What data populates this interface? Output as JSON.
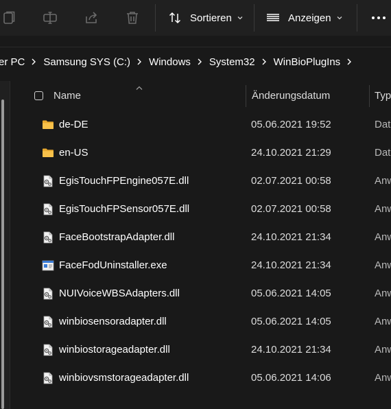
{
  "toolbar": {
    "sort_label": "Sortieren",
    "view_label": "Anzeigen",
    "icons": [
      "copy-icon",
      "rename-icon",
      "share-icon",
      "delete-icon",
      "sort-icon",
      "view-icon",
      "more-icon"
    ]
  },
  "breadcrumb": [
    "er PC",
    "Samsung SYS (C:)",
    "Windows",
    "System32",
    "WinBioPlugIns"
  ],
  "columns": {
    "name": "Name",
    "date": "Änderungsdatum",
    "type": "Typ"
  },
  "files": [
    {
      "name": "de-DE",
      "date": "05.06.2021 19:52",
      "type": "Dat",
      "icon": "folder-icon"
    },
    {
      "name": "en-US",
      "date": "24.10.2021 21:29",
      "type": "Dat",
      "icon": "folder-icon"
    },
    {
      "name": "EgisTouchFPEngine057E.dll",
      "date": "02.07.2021 00:58",
      "type": "Anw",
      "icon": "dll-file-icon"
    },
    {
      "name": "EgisTouchFPSensor057E.dll",
      "date": "02.07.2021 00:58",
      "type": "Anw",
      "icon": "dll-file-icon"
    },
    {
      "name": "FaceBootstrapAdapter.dll",
      "date": "24.10.2021 21:34",
      "type": "Anw",
      "icon": "dll-file-icon"
    },
    {
      "name": "FaceFodUninstaller.exe",
      "date": "24.10.2021 21:34",
      "type": "Anw",
      "icon": "exe-file-icon"
    },
    {
      "name": "NUIVoiceWBSAdapters.dll",
      "date": "05.06.2021 14:05",
      "type": "Anw",
      "icon": "dll-file-icon"
    },
    {
      "name": "winbiosensoradapter.dll",
      "date": "05.06.2021 14:05",
      "type": "Anw",
      "icon": "dll-file-icon"
    },
    {
      "name": "winbiostorageadapter.dll",
      "date": "24.10.2021 21:34",
      "type": "Anw",
      "icon": "dll-file-icon"
    },
    {
      "name": "winbiovsmstorageadapter.dll",
      "date": "05.06.2021 14:06",
      "type": "Anw",
      "icon": "dll-file-icon"
    }
  ],
  "colors": {
    "background": "#191919",
    "toolbar": "#202020",
    "folder": "#F8C14A",
    "exe_accent": "#3A7BD5"
  }
}
